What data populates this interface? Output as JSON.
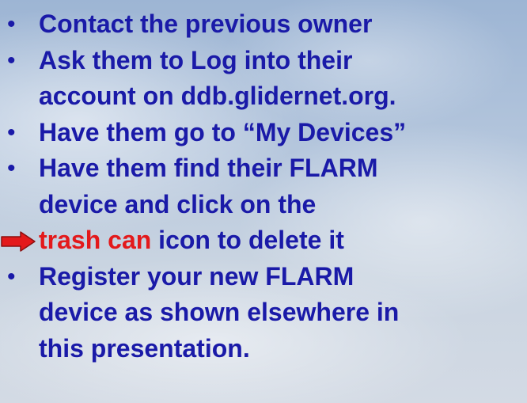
{
  "bullets": [
    {
      "text": "Contact the previous owner"
    },
    {
      "text": "Ask them to Log into their"
    },
    {
      "text": "account on ddb.glidernet.org."
    },
    {
      "text": "Have them go to “My Devices”"
    },
    {
      "text": "Have them find their FLARM"
    },
    {
      "text": "device and click on the"
    },
    {
      "highlight": "trash can",
      "rest": " icon to delete it"
    },
    {
      "text": "Register your new FLARM"
    },
    {
      "text": "device as shown elsewhere in"
    },
    {
      "text": "this presentation."
    }
  ],
  "bullet_glyph": "•",
  "colors": {
    "text": "#1a1aa8",
    "highlight": "#e3191b",
    "arrow_fill": "#e3191b",
    "arrow_stroke": "#8b1010"
  },
  "icons": {
    "pointer": "right-arrow-icon"
  }
}
